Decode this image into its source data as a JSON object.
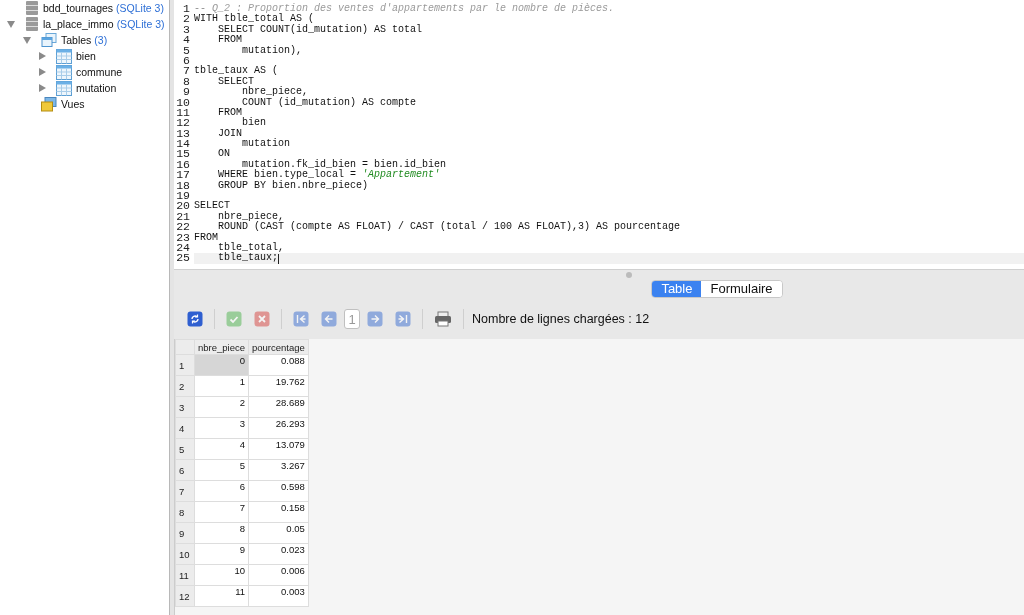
{
  "sidebar": {
    "tree": [
      {
        "label": "bdd_tournages",
        "badge": "(SQLite 3)",
        "kind": "database"
      },
      {
        "label": "la_place_immo",
        "badge": "(SQLite 3)",
        "kind": "database",
        "expanded": true,
        "children": [
          {
            "label": "Tables",
            "badge": "(3)",
            "kind": "tables",
            "expanded": true,
            "children": [
              {
                "label": "bien",
                "kind": "table",
                "expanded": false
              },
              {
                "label": "commune",
                "kind": "table",
                "expanded": false
              },
              {
                "label": "mutation",
                "kind": "table",
                "expanded": false
              }
            ]
          },
          {
            "label": "Vues",
            "kind": "views"
          }
        ]
      }
    ]
  },
  "editor": {
    "lines": [
      {
        "number": "1",
        "tokens": [
          {
            "kind": "comment",
            "text": "-- Q_2 : Proportion des ventes d'appartements par le nombre de pièces."
          }
        ]
      },
      {
        "number": "2",
        "tokens": [
          {
            "kind": "plain",
            "text": "WITH tble_total AS ("
          }
        ]
      },
      {
        "number": "3",
        "tokens": [
          {
            "kind": "plain",
            "text": "    SELECT COUNT(id_mutation) AS total"
          }
        ]
      },
      {
        "number": "4",
        "tokens": [
          {
            "kind": "plain",
            "text": "    FROM"
          }
        ]
      },
      {
        "number": "5",
        "tokens": [
          {
            "kind": "plain",
            "text": "        mutation),"
          }
        ]
      },
      {
        "number": "6"
      },
      {
        "number": "7",
        "tokens": [
          {
            "kind": "plain",
            "text": "tble_taux AS ("
          }
        ]
      },
      {
        "number": "8",
        "tokens": [
          {
            "kind": "plain",
            "text": "    SELECT"
          }
        ]
      },
      {
        "number": "9",
        "tokens": [
          {
            "kind": "plain",
            "text": "        nbre_piece,"
          }
        ]
      },
      {
        "number": "10",
        "tokens": [
          {
            "kind": "plain",
            "text": "        COUNT (id_mutation) AS compte"
          }
        ]
      },
      {
        "number": "11",
        "tokens": [
          {
            "kind": "plain",
            "text": "    FROM"
          }
        ]
      },
      {
        "number": "12",
        "tokens": [
          {
            "kind": "plain",
            "text": "        bien"
          }
        ]
      },
      {
        "number": "13",
        "tokens": [
          {
            "kind": "plain",
            "text": "    JOIN"
          }
        ]
      },
      {
        "number": "14",
        "tokens": [
          {
            "kind": "plain",
            "text": "        mutation"
          }
        ]
      },
      {
        "number": "15",
        "tokens": [
          {
            "kind": "plain",
            "text": "    ON"
          }
        ]
      },
      {
        "number": "16",
        "tokens": [
          {
            "kind": "plain",
            "text": "        mutation.fk_id_bien = bien.id_bien"
          }
        ]
      },
      {
        "number": "17",
        "tokens": [
          {
            "kind": "plain",
            "text": "    WHERE bien.type_local = "
          },
          {
            "kind": "string",
            "text": "'Appartement'"
          }
        ]
      },
      {
        "number": "18",
        "tokens": [
          {
            "kind": "plain",
            "text": "    GROUP BY bien.nbre_piece)"
          }
        ]
      },
      {
        "number": "19"
      },
      {
        "number": "20",
        "tokens": [
          {
            "kind": "plain",
            "text": "SELECT"
          }
        ]
      },
      {
        "number": "21",
        "tokens": [
          {
            "kind": "plain",
            "text": "    nbre_piece,"
          }
        ]
      },
      {
        "number": "22",
        "tokens": [
          {
            "kind": "plain",
            "text": "    ROUND (CAST (compte AS FLOAT) / CAST (total / 100 AS FLOAT),3) AS pourcentage"
          }
        ]
      },
      {
        "number": "23",
        "tokens": [
          {
            "kind": "plain",
            "text": "FROM"
          }
        ]
      },
      {
        "number": "24",
        "tokens": [
          {
            "kind": "plain",
            "text": "    tble_total,"
          }
        ]
      },
      {
        "number": "25",
        "current": true,
        "tokens": [
          {
            "kind": "plain",
            "text": "    tble_taux;"
          }
        ]
      }
    ]
  },
  "view_tabs": [
    {
      "label": "Table",
      "selected": true
    },
    {
      "label": "Formulaire",
      "selected": false
    }
  ],
  "toolbar": {
    "buttons": [
      {
        "kind": "refresh",
        "disabled": false
      },
      {
        "kind": "separator"
      },
      {
        "kind": "commit",
        "disabled": true
      },
      {
        "kind": "rollback",
        "disabled": true
      },
      {
        "kind": "separator"
      },
      {
        "kind": "first",
        "disabled": true
      },
      {
        "kind": "prev",
        "disabled": true
      },
      {
        "kind": "page",
        "value": "1"
      },
      {
        "kind": "next",
        "disabled": true
      },
      {
        "kind": "last",
        "disabled": true
      },
      {
        "kind": "separator"
      },
      {
        "kind": "print",
        "disabled": false
      },
      {
        "kind": "separator"
      }
    ],
    "status": "Nombre de lignes chargées : 12"
  },
  "table": {
    "columns": [
      "nbre_piece",
      "pourcentage"
    ],
    "rows": [
      {
        "number": "1",
        "cells": [
          {
            "text": "0",
            "selected": true
          },
          {
            "text": "0.088",
            "selected": false
          }
        ]
      },
      {
        "number": "2",
        "cells": [
          {
            "text": "1",
            "selected": false
          },
          {
            "text": "19.762",
            "selected": false
          }
        ]
      },
      {
        "number": "3",
        "cells": [
          {
            "text": "2",
            "selected": false
          },
          {
            "text": "28.689",
            "selected": false
          }
        ]
      },
      {
        "number": "4",
        "cells": [
          {
            "text": "3",
            "selected": false
          },
          {
            "text": "26.293",
            "selected": false
          }
        ]
      },
      {
        "number": "5",
        "cells": [
          {
            "text": "4",
            "selected": false
          },
          {
            "text": "13.079",
            "selected": false
          }
        ]
      },
      {
        "number": "6",
        "cells": [
          {
            "text": "5",
            "selected": false
          },
          {
            "text": "3.267",
            "selected": false
          }
        ]
      },
      {
        "number": "7",
        "cells": [
          {
            "text": "6",
            "selected": false
          },
          {
            "text": "0.598",
            "selected": false
          }
        ]
      },
      {
        "number": "8",
        "cells": [
          {
            "text": "7",
            "selected": false
          },
          {
            "text": "0.158",
            "selected": false
          }
        ]
      },
      {
        "number": "9",
        "cells": [
          {
            "text": "8",
            "selected": false
          },
          {
            "text": "0.05",
            "selected": false
          }
        ]
      },
      {
        "number": "10",
        "cells": [
          {
            "text": "9",
            "selected": false
          },
          {
            "text": "0.023",
            "selected": false
          }
        ]
      },
      {
        "number": "11",
        "cells": [
          {
            "text": "10",
            "selected": false
          },
          {
            "text": "0.006",
            "selected": false
          }
        ]
      },
      {
        "number": "12",
        "cells": [
          {
            "text": "11",
            "selected": false
          },
          {
            "text": "0.003",
            "selected": false
          }
        ]
      }
    ]
  }
}
